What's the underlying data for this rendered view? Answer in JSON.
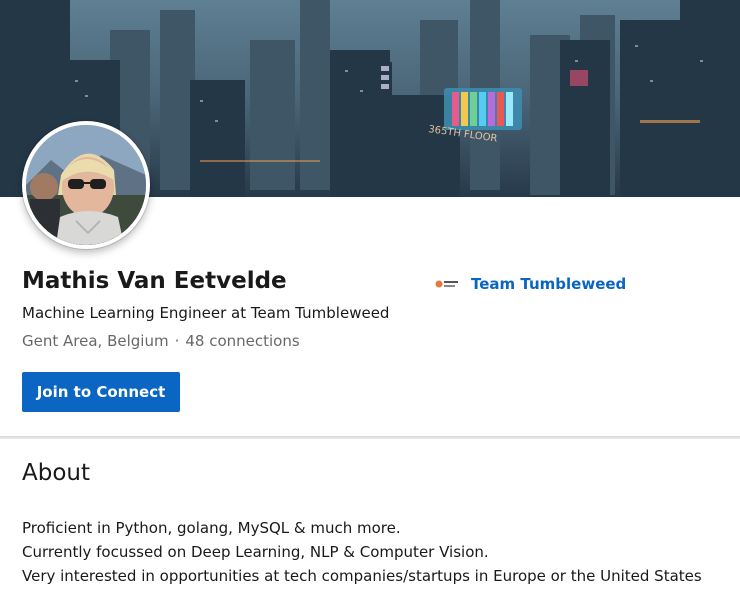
{
  "profile": {
    "name": "Mathis Van Eetvelde",
    "headline": "Machine Learning Engineer at Team Tumbleweed",
    "location": "Gent Area, Belgium",
    "separator": "·",
    "connections": "48 connections",
    "company": "Team Tumbleweed",
    "join_button": "Join to Connect"
  },
  "about": {
    "title": "About",
    "lines": [
      "Proficient in Python, golang, MySQL & much more.",
      "Currently focussed on Deep Learning, NLP & Computer Vision.",
      "Very interested in opportunities at tech companies/startups in Europe or the United States"
    ]
  },
  "colors": {
    "accent": "#0a66c2",
    "button_text": "#ffffff"
  },
  "cover": {
    "sign_text": "365TH FLOOR"
  }
}
